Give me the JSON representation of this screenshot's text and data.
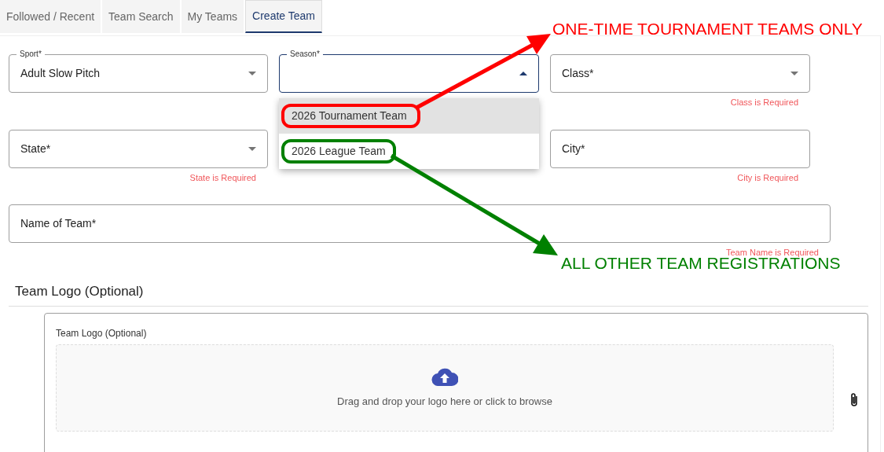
{
  "tabs": [
    {
      "label": "Followed / Recent",
      "selected": false
    },
    {
      "label": "Team Search",
      "selected": false
    },
    {
      "label": "My Teams",
      "selected": false
    },
    {
      "label": "Create Team",
      "selected": true
    }
  ],
  "field_rows": [
    [
      {
        "kind": "select",
        "label": "Sport*",
        "value": "Adult Slow Pitch",
        "focused": false
      },
      {
        "kind": "select",
        "label": "Season*",
        "focused": true,
        "open": true,
        "options": [
          {
            "label": "2026 Tournament Team",
            "highlighted": true,
            "annotation": {
              "text": "ONE-TIME TOURNAMENT TEAMS ONLY",
              "color": "#ff0000"
            }
          },
          {
            "label": "2026 League Team",
            "highlighted": false,
            "annotation": {
              "text": "ALL OTHER TEAM REGISTRATIONS",
              "color": "#008000"
            }
          }
        ]
      },
      {
        "kind": "select",
        "label": "Class*",
        "focused": false,
        "error": "Class is Required"
      }
    ],
    [
      {
        "kind": "select",
        "label": "State*",
        "focused": false,
        "error": "State is Required"
      },
      {
        "kind": "hidden"
      },
      {
        "kind": "text",
        "label": "City*",
        "focused": false,
        "error": "City is Required"
      }
    ],
    [
      {
        "kind": "text",
        "label": "Name of Team*",
        "focused": false,
        "error": "Team Name is Required",
        "wide": true
      }
    ]
  ],
  "logo_section": {
    "heading": "Team Logo (Optional)",
    "label": "Team Logo (Optional)",
    "drop_text": "Drag and drop your logo here or click to browse"
  }
}
